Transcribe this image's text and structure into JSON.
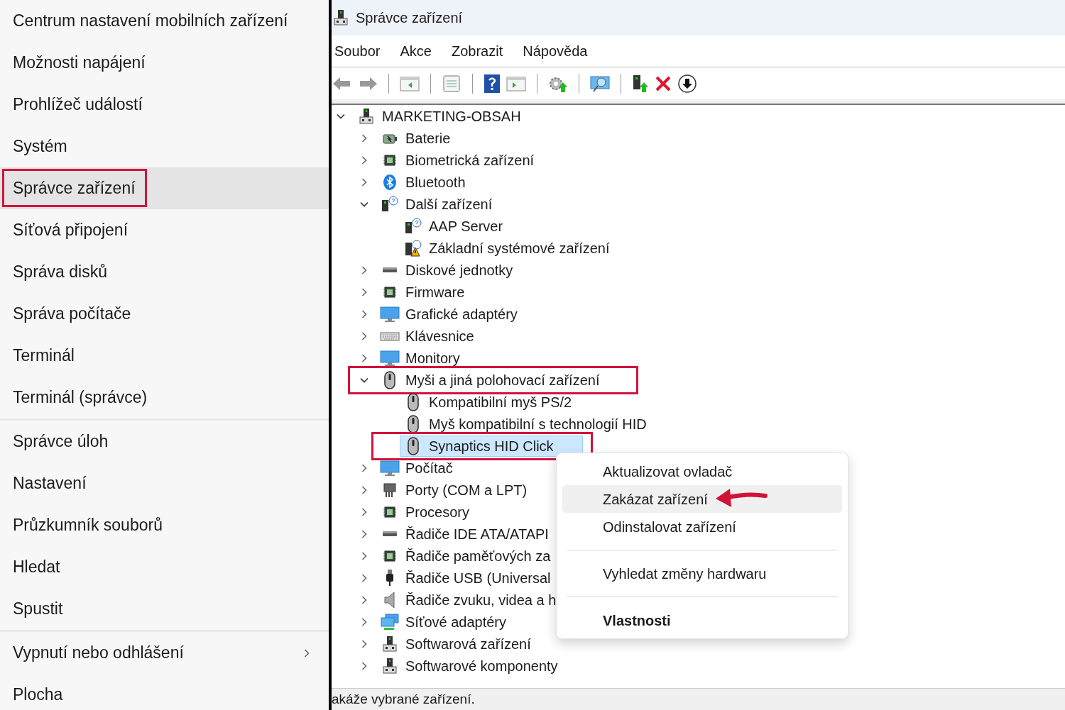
{
  "quick_menu": {
    "groups": [
      {
        "items": [
          {
            "label": "Centrum nastavení mobilních zařízení",
            "selected": false,
            "framed": false,
            "submenu": false
          },
          {
            "label": "Možnosti napájení",
            "selected": false,
            "framed": false,
            "submenu": false
          },
          {
            "label": "Prohlížeč událostí",
            "selected": false,
            "framed": false,
            "submenu": false
          },
          {
            "label": "Systém",
            "selected": false,
            "framed": false,
            "submenu": false
          },
          {
            "label": "Správce zařízení",
            "selected": true,
            "framed": true,
            "submenu": false
          },
          {
            "label": "Síťová připojení",
            "selected": false,
            "framed": false,
            "submenu": false
          },
          {
            "label": "Správa disků",
            "selected": false,
            "framed": false,
            "submenu": false
          },
          {
            "label": "Správa počítače",
            "selected": false,
            "framed": false,
            "submenu": false
          },
          {
            "label": "Terminál",
            "selected": false,
            "framed": false,
            "submenu": false
          },
          {
            "label": "Terminál (správce)",
            "selected": false,
            "framed": false,
            "submenu": false
          }
        ]
      },
      {
        "items": [
          {
            "label": "Správce úloh",
            "selected": false,
            "framed": false,
            "submenu": false
          },
          {
            "label": "Nastavení",
            "selected": false,
            "framed": false,
            "submenu": false
          },
          {
            "label": "Průzkumník souborů",
            "selected": false,
            "framed": false,
            "submenu": false
          },
          {
            "label": "Hledat",
            "selected": false,
            "framed": false,
            "submenu": false
          },
          {
            "label": "Spustit",
            "selected": false,
            "framed": false,
            "submenu": false
          }
        ]
      },
      {
        "items": [
          {
            "label": "Vypnutí nebo odhlášení",
            "selected": false,
            "framed": false,
            "submenu": true
          },
          {
            "label": "Plocha",
            "selected": false,
            "framed": false,
            "submenu": false
          }
        ]
      }
    ]
  },
  "window": {
    "title": "Správce zařízení",
    "menu": [
      "Soubor",
      "Akce",
      "Zobrazit",
      "Nápověda"
    ],
    "tree": [
      {
        "label": "MARKETING-OBSAH",
        "expanded": true,
        "selected": false,
        "framed": false,
        "children": [
          {
            "label": "Baterie",
            "expanded": false,
            "selected": false,
            "framed": false
          },
          {
            "label": "Biometrická zařízení",
            "expanded": false,
            "selected": false,
            "framed": false
          },
          {
            "label": "Bluetooth",
            "expanded": false,
            "selected": false,
            "framed": false
          },
          {
            "label": "Další zařízení",
            "expanded": true,
            "selected": false,
            "framed": false,
            "children": [
              {
                "label": "AAP Server",
                "selected": false,
                "framed": false
              },
              {
                "label": "Základní systémové zařízení",
                "selected": false,
                "framed": false
              }
            ]
          },
          {
            "label": "Diskové jednotky",
            "expanded": false,
            "selected": false,
            "framed": false
          },
          {
            "label": "Firmware",
            "expanded": false,
            "selected": false,
            "framed": false
          },
          {
            "label": "Grafické adaptéry",
            "expanded": false,
            "selected": false,
            "framed": false
          },
          {
            "label": "Klávesnice",
            "expanded": false,
            "selected": false,
            "framed": false
          },
          {
            "label": "Monitory",
            "expanded": false,
            "selected": false,
            "framed": false
          },
          {
            "label": "Myši a jiná polohovací zařízení",
            "expanded": true,
            "selected": false,
            "framed": true,
            "children": [
              {
                "label": "Kompatibilní myš PS/2",
                "selected": false,
                "framed": false
              },
              {
                "label": "Myš kompatibilní s technologií HID",
                "selected": false,
                "framed": false
              },
              {
                "label": "Synaptics HID Click",
                "selected": true,
                "framed": true
              }
            ]
          },
          {
            "label": "Počítač",
            "expanded": false,
            "selected": false,
            "framed": false
          },
          {
            "label": "Porty (COM a LPT)",
            "expanded": false,
            "selected": false,
            "framed": false
          },
          {
            "label": "Procesory",
            "expanded": false,
            "selected": false,
            "framed": false
          },
          {
            "label": "Řadiče IDE ATA/ATAPI",
            "expanded": false,
            "selected": false,
            "framed": false
          },
          {
            "label": "Řadiče paměťových za",
            "expanded": false,
            "selected": false,
            "framed": false
          },
          {
            "label": "Řadiče USB (Universal",
            "expanded": false,
            "selected": false,
            "framed": false
          },
          {
            "label": "Řadiče zvuku, videa a h",
            "expanded": false,
            "selected": false,
            "framed": false
          },
          {
            "label": "Síťové adaptéry",
            "expanded": false,
            "selected": false,
            "framed": false
          },
          {
            "label": "Softwarová zařízení",
            "expanded": false,
            "selected": false,
            "framed": false
          },
          {
            "label": "Softwarové komponenty",
            "expanded": false,
            "selected": false,
            "framed": false
          }
        ]
      }
    ],
    "context_menu": [
      {
        "kind": "item",
        "label": "Aktualizovat ovladač",
        "selected": false,
        "default": false,
        "pointed": false
      },
      {
        "kind": "item",
        "label": "Zakázat zařízení",
        "selected": true,
        "default": false,
        "pointed": true
      },
      {
        "kind": "item",
        "label": "Odinstalovat zařízení",
        "selected": false,
        "default": false,
        "pointed": false
      },
      {
        "kind": "separator"
      },
      {
        "kind": "item",
        "label": "Vyhledat změny hardwaru",
        "selected": false,
        "default": false,
        "pointed": false
      },
      {
        "kind": "separator"
      },
      {
        "kind": "item",
        "label": "Vlastnosti",
        "selected": false,
        "default": true,
        "pointed": false
      }
    ],
    "status_bar": "akáže vybrané zařízení."
  }
}
